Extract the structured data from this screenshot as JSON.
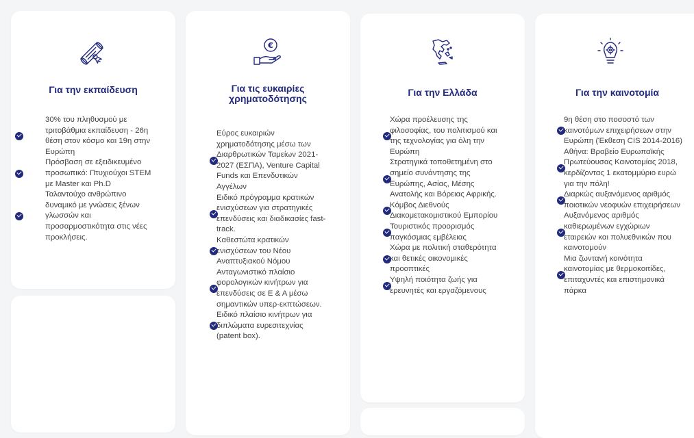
{
  "accent_color": "#222a7d",
  "cards": [
    {
      "icon": "diploma-scroll-icon",
      "title": "Για την εκπαίδευση",
      "features": [
        "30% του πληθυσμού με τριτοβάθμια εκπαίδευση - 26η θέση στον κόσμο και 19η στην Ευρώπη",
        "Πρόσβαση σε εξειδικευμένο προσωπικό: Πτυχιούχοι STEM με Master και Ph.D",
        "Ταλαντούχο ανθρώπινο δυναμικό με γνώσεις ξένων γλωσσών και προσαρμοστικότητα στις νέες προκλήσεις."
      ]
    },
    {
      "icon": "euro-coin-hand-icon",
      "title": "Για τις ευκαιρίες χρηματοδότησης",
      "features": [
        "Εύρος ευκαιριών χρηματοδότησης μέσω των Διαρθρωτικών Ταμείων 2021-2027 (ΕΣΠΑ), Venture Capital Funds και Επενδυτικών Αγγέλων",
        "Ειδικό πρόγραμμα κρατικών ενισχύσεων για στρατηγικές επενδύσεις και διαδικασίες fast-track.",
        "Καθεστώτα κρατικών ενισχύσεων του Νέου Αναπτυξιακού Νόμου",
        "Ανταγωνιστικό πλαίσιο φορολογικών κινήτρων για επενδύσεις σε Ε & Α μέσω σημαντικών υπερ-εκπτώσεων.",
        "Ειδικό πλαίσιο κινήτρων για διπλώματα ευρεσιτεχνίας (patent box)."
      ]
    },
    {
      "icon": "greece-map-icon",
      "title": "Για την Ελλάδα",
      "features": [
        "Χώρα προέλευσης της φιλοσοφίας, του πολιτισμού και της τεχνολογίας για όλη την Ευρώπη",
        "Στρατηγικά τοποθετημένη στο σημείο συνάντησης της Ευρώπης, Ασίας, Μέσης Ανατολής και Βόρειας Αφρικής.",
        "Κόμβος Διεθνούς Διακομετακομιστικού Εμπορίου",
        "Τουριστικός προορισμός παγκόσμιας εμβέλειας",
        "Χώρα με πολιτική σταθερότητα και θετικές οικονομικές προοπτικές",
        "Υψηλή ποιότητα ζωής για ερευνητές και εργαζόμενους"
      ]
    },
    {
      "icon": "lightbulb-gear-icon",
      "title": "Για την καινοτομία",
      "features": [
        "9η θέση στο ποσοστό των καινοτόμων επιχειρήσεων στην Ευρώπη (Έκθεση CIS 2014-2016)",
        "Αθήνα: Βραβείο Ευρωπαϊκής Πρωτεύουσας Καινοτομίας 2018, κερδίζοντας 1 εκατομμύριο ευρώ για την πόλη!",
        "Διαρκώς αυξανόμενος αριθμός ποιοτικών νεοφυών επιχειρήσεων",
        "Αυξανόμενος αριθμός καθιερωμένων εγχώριων εταιρειών και πολυεθνικών που καινοτομούν",
        "Μια ζωντανή κοινότητα καινοτομίας με θερμοκοιτίδες, επιταχυντές και επιστημονικά πάρκα"
      ]
    }
  ]
}
